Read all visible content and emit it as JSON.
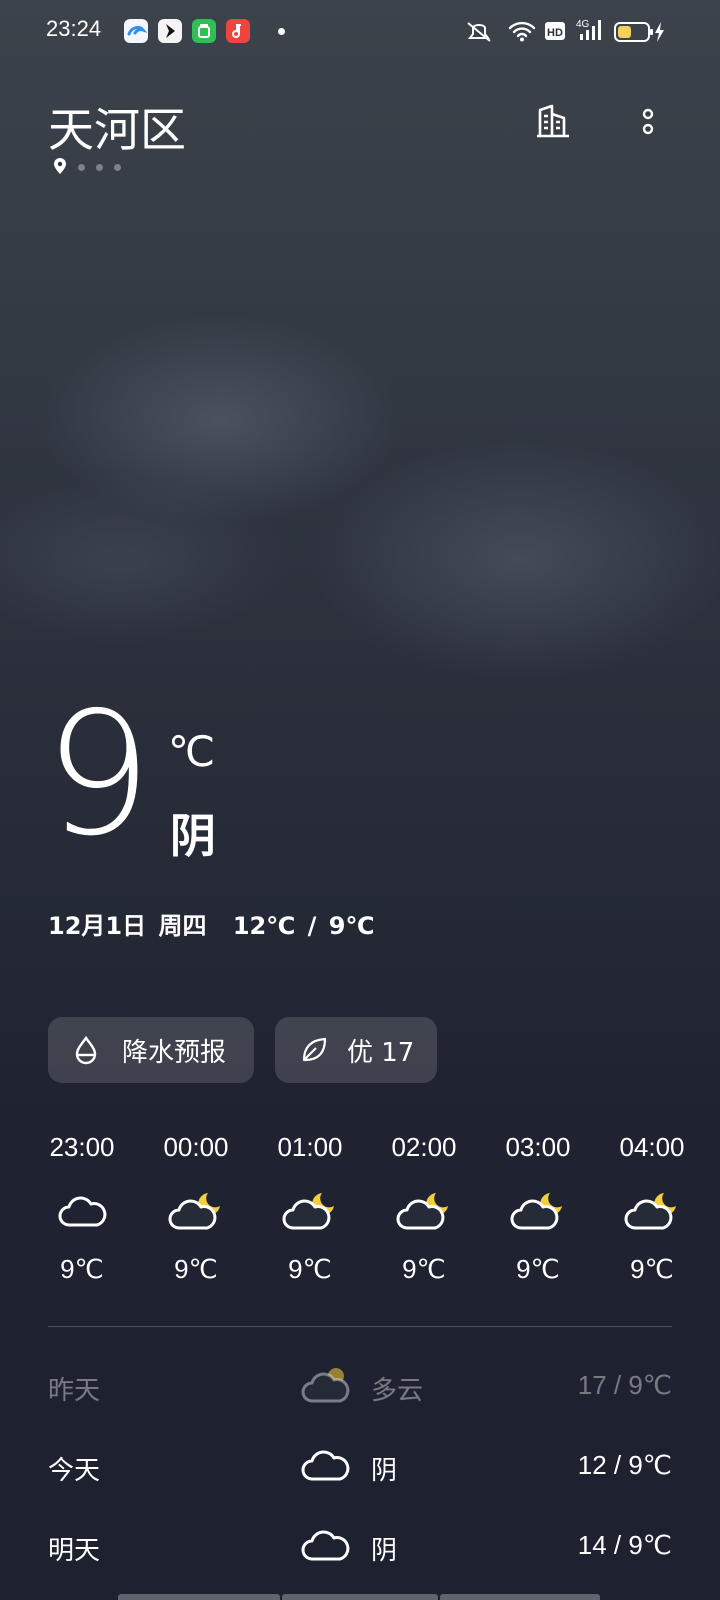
{
  "status_bar": {
    "time": "23:24",
    "notification_icons": [
      "browser-app-icon",
      "bird-app-icon",
      "shop-app-icon",
      "music-app-icon"
    ],
    "network": "4G",
    "hd_label": "HD",
    "battery_level": 0.45,
    "charging": true
  },
  "header": {
    "city": "天河区",
    "page_count": 4,
    "active_page": 0
  },
  "current": {
    "temp": "9",
    "unit": "℃",
    "condition": "阴",
    "date": "12月1日",
    "weekday": "周四",
    "range": "12℃ / 9℃"
  },
  "chips": {
    "precip_label": "降水预报",
    "aqi_label": "优 17"
  },
  "hourly": [
    {
      "time": "23:00",
      "icon": "cloud-icon",
      "temp": "9℃"
    },
    {
      "time": "00:00",
      "icon": "cloud-moon-icon",
      "temp": "9℃"
    },
    {
      "time": "01:00",
      "icon": "cloud-moon-icon",
      "temp": "9℃"
    },
    {
      "time": "02:00",
      "icon": "cloud-moon-icon",
      "temp": "9℃"
    },
    {
      "time": "03:00",
      "icon": "cloud-moon-icon",
      "temp": "9℃"
    },
    {
      "time": "04:00",
      "icon": "cloud-moon-icon",
      "temp": "9℃"
    }
  ],
  "daily": [
    {
      "day": "昨天",
      "icon": "partly-cloudy-icon",
      "condition": "多云",
      "range": "17 / 9℃",
      "dim": true
    },
    {
      "day": "今天",
      "icon": "cloud-icon",
      "condition": "阴",
      "range": "12 / 9℃",
      "dim": false
    },
    {
      "day": "明天",
      "icon": "cloud-icon",
      "condition": "阴",
      "range": "14 / 9℃",
      "dim": false
    }
  ],
  "colors": {
    "moon": "#f5cf3a",
    "text": "#ffffff",
    "chip_bg": "rgba(255,255,255,0.14)"
  }
}
